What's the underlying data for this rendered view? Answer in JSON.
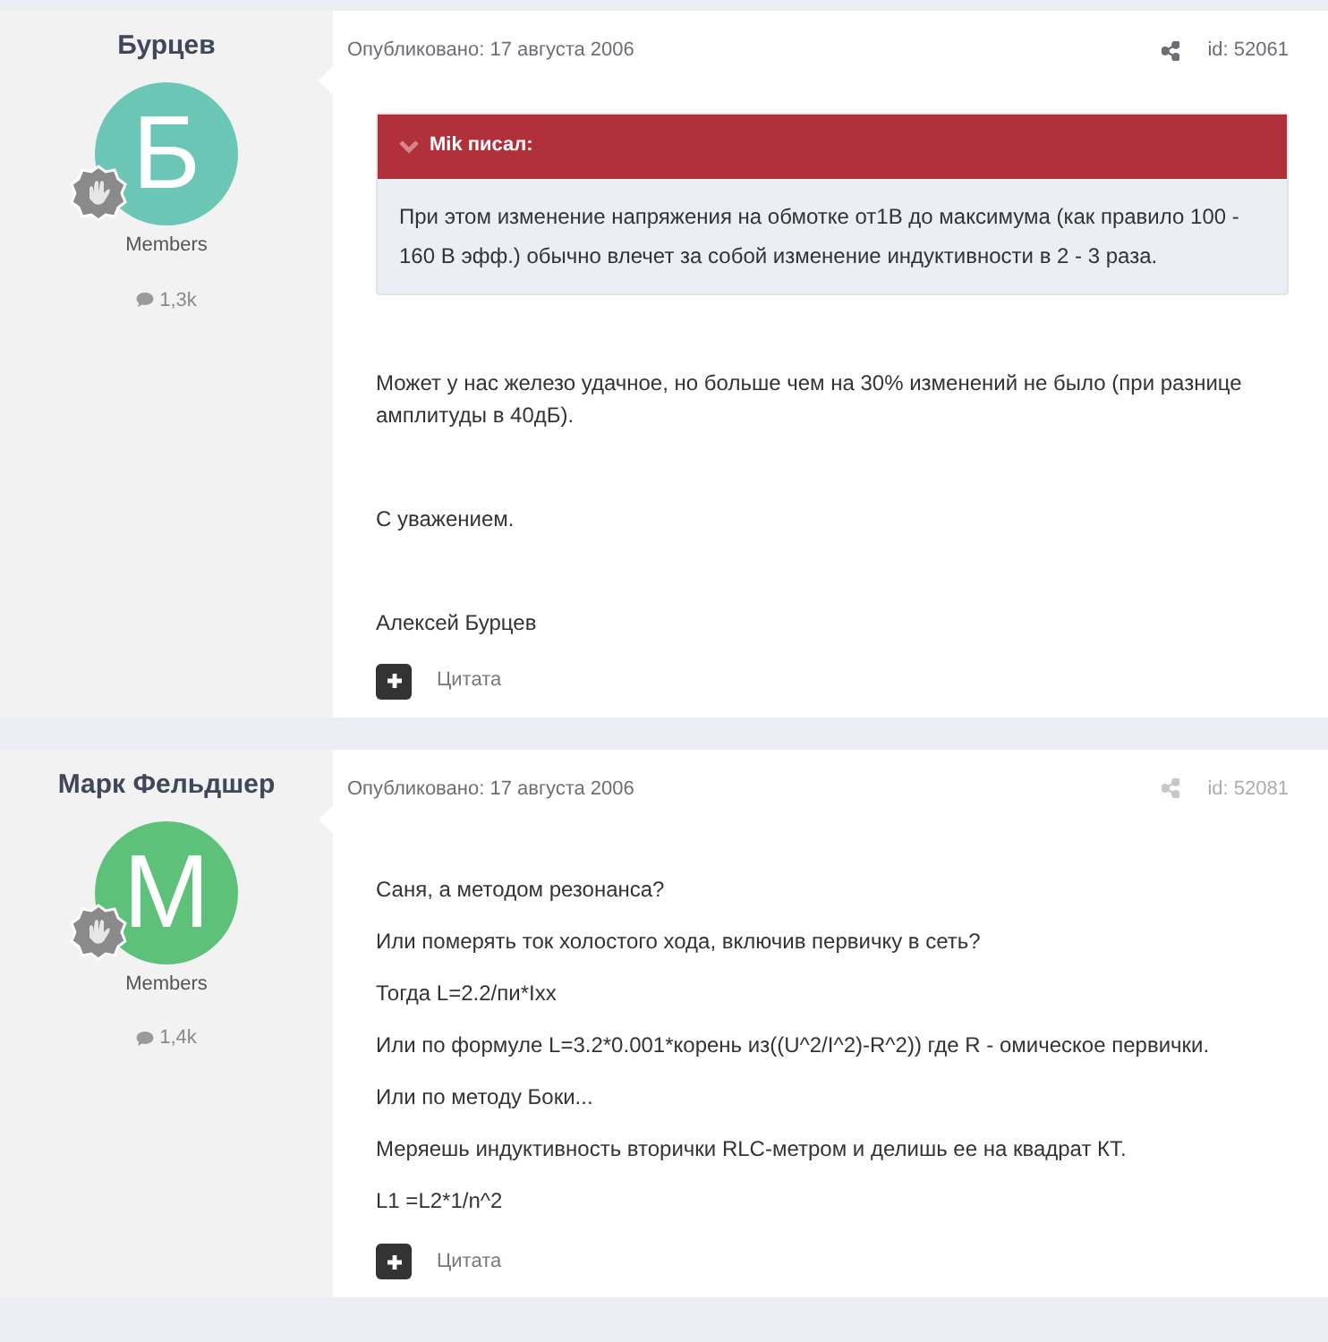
{
  "posts": [
    {
      "author": "Бурцев",
      "avatar_letter": "Б",
      "color": "#6cc6b6",
      "group": "Members",
      "post_count": "1,3k",
      "date": "Опубликовано: 17 августа 2006",
      "post_id": "id: 52061",
      "faded_meta": false,
      "quote": {
        "header": "Mik писал:",
        "text": "При этом изменение напряжения на обмотке от1В до максимума (как правило 100 - 160 В эфф.) обычно влечет за собой изменение индуктивности в 2 - 3 раза."
      },
      "paragraphs": [
        "Может у нас железо удачное, но больше чем на 30% изменений не было (при разнице амплитуды в 40дБ).",
        "С уважением.",
        "Алексей Бурцев"
      ],
      "quote_button": "Цитата"
    },
    {
      "author": "Марк Фельдшер",
      "avatar_letter": "M",
      "color": "#5ec17a",
      "group": "Members",
      "post_count": "1,4k",
      "date": "Опубликовано: 17 августа 2006",
      "post_id": "id: 52081",
      "faded_meta": true,
      "paragraphs": [
        "Саня, а методом резонанса?",
        "Или померять ток холостого хода, включив первичку в сеть?",
        "Тогда L=2.2/пи*Ixx",
        "Или по формуле L=3.2*0.001*корень из((U^2/I^2)-R^2)) где R - омическое первички.",
        "Или по методу Боки...",
        "Меряешь индуктивность вторички RLC-метром и делишь ее на квадрат КТ.",
        "L1 =L2*1/n^2"
      ],
      "quote_button": "Цитата"
    }
  ]
}
